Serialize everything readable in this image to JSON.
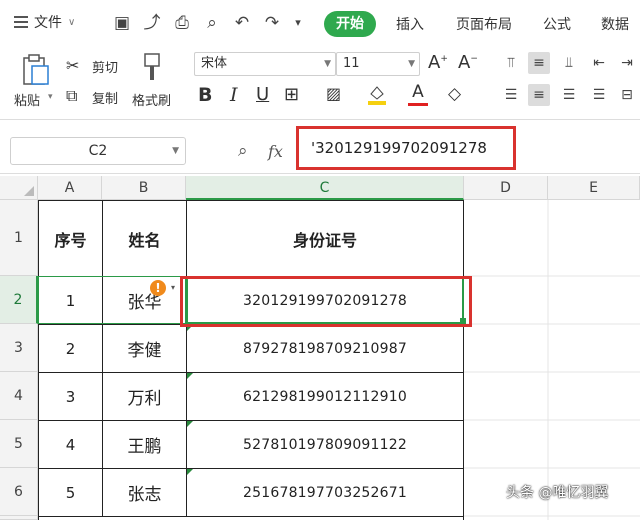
{
  "menu": {
    "file": "文件",
    "tabs": [
      "开始",
      "插入",
      "页面布局",
      "公式",
      "数据"
    ]
  },
  "ribbon": {
    "paste": "粘贴",
    "cut": "剪切",
    "copy": "复制",
    "format_painter": "格式刷",
    "font_name": "宋体",
    "font_size": "11"
  },
  "formula_bar": {
    "cell_ref": "C2",
    "fx": "fx",
    "content": "'320129199702091278"
  },
  "columns": [
    "A",
    "B",
    "C",
    "D",
    "E"
  ],
  "rows": [
    "1",
    "2",
    "3",
    "4",
    "5",
    "6"
  ],
  "table": {
    "headers": [
      "序号",
      "姓名",
      "身份证号"
    ],
    "rows": [
      [
        "1",
        "张华",
        "320129199702091278"
      ],
      [
        "2",
        "李健",
        "879278198709210987"
      ],
      [
        "3",
        "万利",
        "621298199012112910"
      ],
      [
        "4",
        "王鹏",
        "527810197809091122"
      ],
      [
        "5",
        "张志",
        "251678197703252671"
      ]
    ]
  },
  "watermark": "头条 @唯忆羽翼",
  "colors": {
    "accent": "#2fa94e",
    "highlight": "#d9322e",
    "warning": "#f08a1c"
  }
}
